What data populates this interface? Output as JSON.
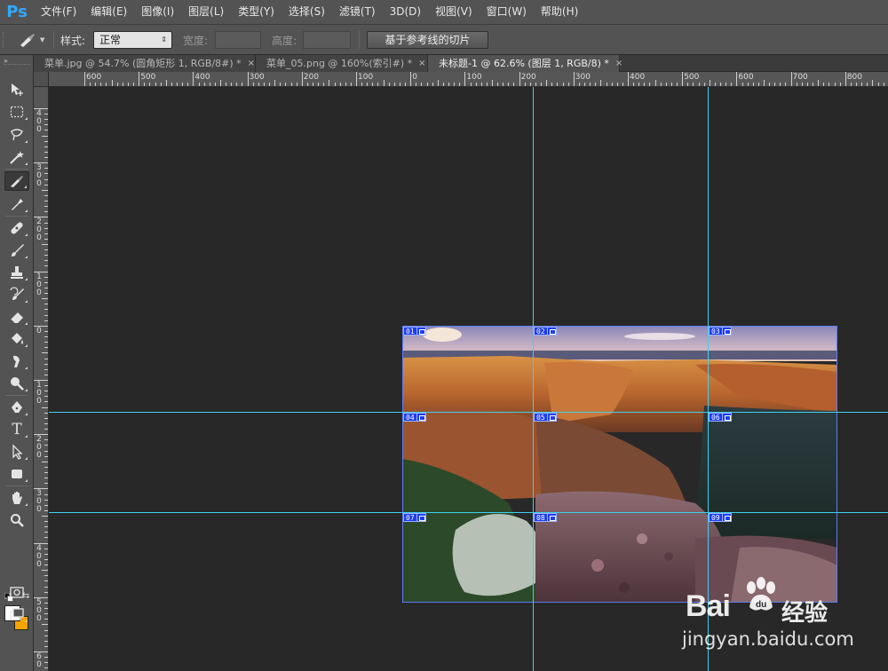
{
  "app": {
    "logo": "Ps"
  },
  "menu": [
    "文件(F)",
    "编辑(E)",
    "图像(I)",
    "图层(L)",
    "类型(Y)",
    "选择(S)",
    "滤镜(T)",
    "3D(D)",
    "视图(V)",
    "窗口(W)",
    "帮助(H)"
  ],
  "options": {
    "style_label": "样式:",
    "style_value": "正常",
    "width_label": "宽度:",
    "height_label": "高度:",
    "slice_button": "基于参考线的切片"
  },
  "tabs": [
    {
      "label": "菜单.jpg @ 54.7% (圆角矩形 1, RGB/8#) *",
      "close": "×",
      "active": false
    },
    {
      "label": "菜单_05.png @ 160%(索引#) *",
      "close": "×",
      "active": false
    },
    {
      "label": "未标题-1 @ 62.6% (图层 1, RGB/8) *",
      "close": "×",
      "active": true
    }
  ],
  "rulers": {
    "horizontal_labels": [
      "600",
      "500",
      "400",
      "300",
      "200",
      "100",
      "0",
      "100",
      "200",
      "300",
      "400",
      "500",
      "600",
      "700",
      "800"
    ],
    "vertical_labels": [
      "4\n0\n0",
      "3\n0\n0",
      "2\n0\n0",
      "1\n0\n0",
      "0",
      "1\n0\n0",
      "2\n0\n0",
      "3\n0\n0",
      "4\n0\n0",
      "5\n0\n0",
      "6\n0"
    ]
  },
  "slices": [
    "01",
    "02",
    "03",
    "04",
    "05",
    "06",
    "07",
    "08",
    "09"
  ],
  "tools": [
    "move-tool",
    "marquee-tool",
    "lasso-tool",
    "magic-wand-tool",
    "slice-tool",
    "eyedropper-tool",
    "healing-brush-tool",
    "brush-tool",
    "clone-stamp-tool",
    "history-brush-tool",
    "eraser-tool",
    "paint-bucket-tool",
    "smudge-tool",
    "dodge-tool",
    "pen-tool",
    "type-tool",
    "path-selection-tool",
    "rectangle-tool",
    "hand-tool",
    "zoom-tool"
  ],
  "type_tool_glyph": "T",
  "colors": {
    "foreground": "#ffffff",
    "background": "#f5a300",
    "guide": "#3fd0ee",
    "slice": "#1d3df0"
  },
  "watermark": {
    "brand": "Bai",
    "brand_cn": "经验",
    "url": "jingyan.baidu.com"
  }
}
